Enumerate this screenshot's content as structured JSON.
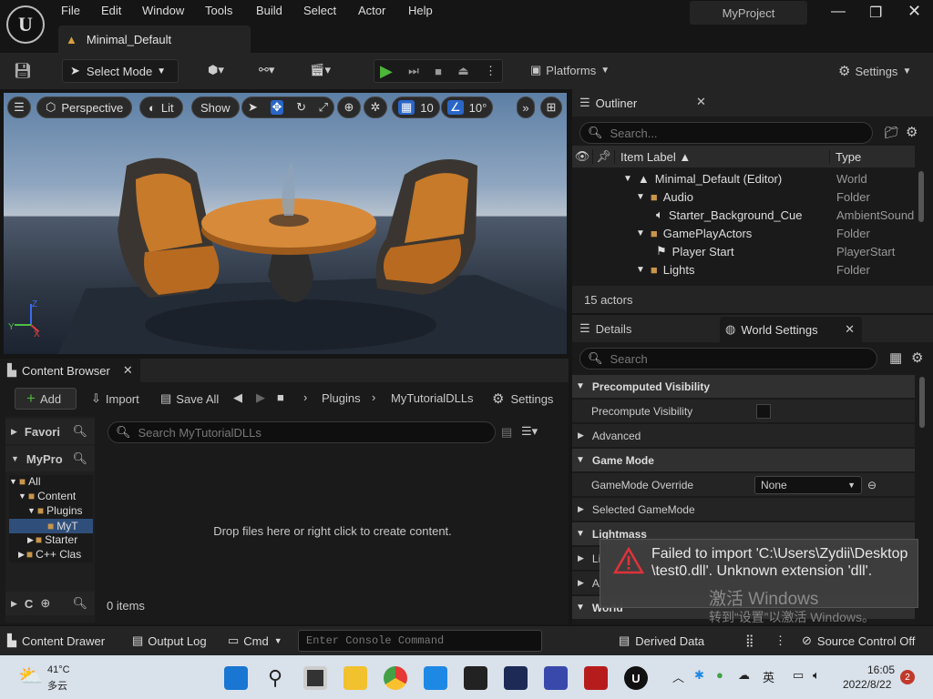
{
  "menu": [
    "File",
    "Edit",
    "Window",
    "Tools",
    "Build",
    "Select",
    "Actor",
    "Help"
  ],
  "level_tab": "Minimal_Default",
  "project": "MyProject",
  "toolbar": {
    "select_mode": "Select Mode",
    "platforms": "Platforms",
    "settings": "Settings"
  },
  "viewport": {
    "perspective": "Perspective",
    "lit": "Lit",
    "show": "Show",
    "grid_snap": "10",
    "angle_snap": "10°"
  },
  "outliner": {
    "title": "Outliner",
    "search_placeholder": "Search...",
    "col_label": "Item Label",
    "col_type": "Type",
    "rows": [
      {
        "label": "Minimal_Default (Editor)",
        "type": "World"
      },
      {
        "label": "Audio",
        "type": "Folder"
      },
      {
        "label": "Starter_Background_Cue",
        "type": "AmbientSound"
      },
      {
        "label": "GamePlayActors",
        "type": "Folder"
      },
      {
        "label": "Player Start",
        "type": "PlayerStart"
      },
      {
        "label": "Lights",
        "type": "Folder"
      }
    ],
    "count": "15 actors"
  },
  "details": {
    "tab_details": "Details",
    "tab_world": "World Settings",
    "search_placeholder": "Search",
    "cat_precomputed": "Precomputed Visibility",
    "prop_precompute": "Precompute Visibility",
    "prop_advanced": "Advanced",
    "cat_gamemode": "Game Mode",
    "prop_gamemode_override": "GameMode Override",
    "gamemode_value": "None",
    "prop_selected_gamemode": "Selected GameMode",
    "cat_lightmass": "Lightmass",
    "row_li": "Li",
    "row_a": "A",
    "cat_world": "World"
  },
  "content_browser": {
    "title": "Content Browser",
    "add": "Add",
    "import": "Import",
    "save_all": "Save All",
    "crumb1": "Plugins",
    "crumb2": "MyTutorialDLLs",
    "settings": "Settings",
    "favorites": "Favori",
    "myproject": "MyPro",
    "tree": [
      "All",
      "Content",
      "Plugins",
      "MyT",
      "Starter",
      "C++ Clas"
    ],
    "collections": "C",
    "search_placeholder": "Search MyTutorialDLLs",
    "empty_msg": "Drop files here or right click to create content.",
    "items": "0 items"
  },
  "statusbar": {
    "content_drawer": "Content Drawer",
    "output_log": "Output Log",
    "cmd": "Cmd",
    "console_placeholder": "Enter Console Command",
    "derived_data": "Derived Data",
    "source_control": "Source Control Off"
  },
  "toast": {
    "message": "Failed to import 'C:\\Users\\Zydii\\Desktop\\test0.dll'. Unknown extension 'dll'."
  },
  "watermark": {
    "line1": "激活 Windows",
    "line2": "转到“设置”以激活 Windows。"
  },
  "taskbar": {
    "temp": "41°C",
    "weather": "多云",
    "time": "16:05",
    "date": "2022/8/22",
    "lang": "英",
    "notif": "2"
  },
  "colors": {
    "accent": "#ff8a00",
    "play": "#4db53a",
    "error": "#e0323a",
    "folder": "#c9954a"
  }
}
